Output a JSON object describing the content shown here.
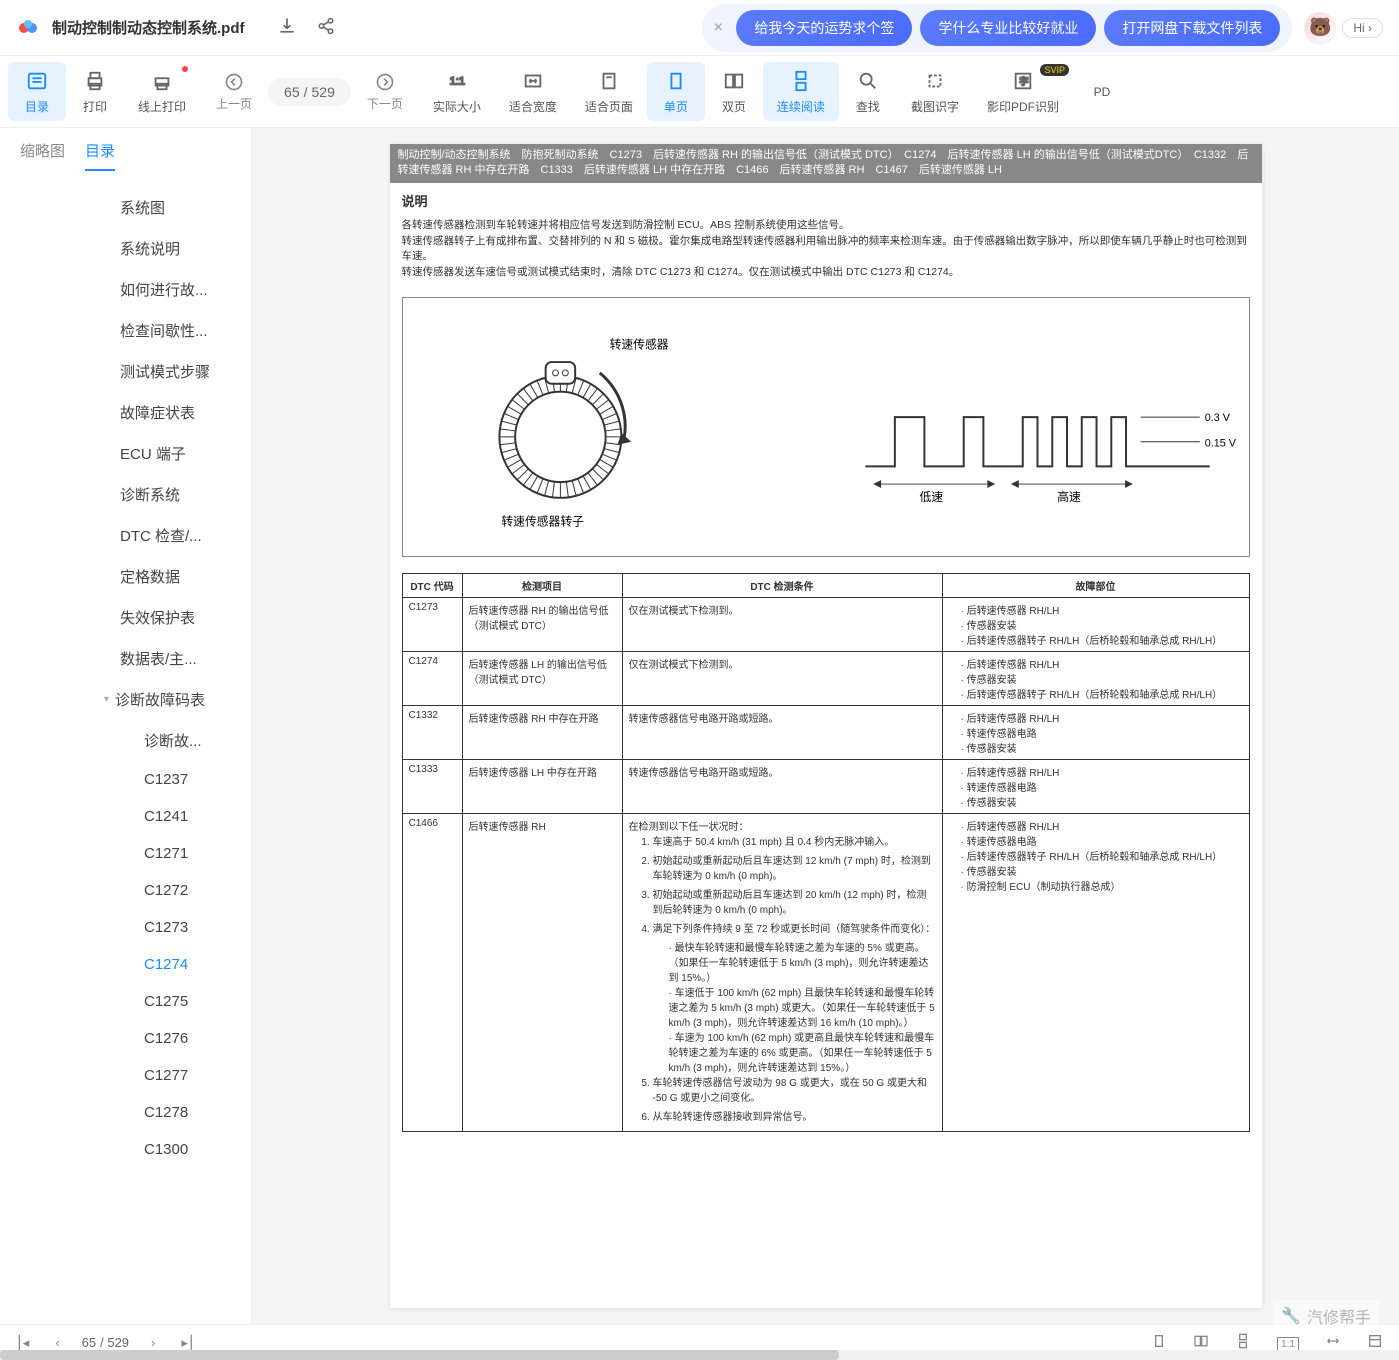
{
  "header": {
    "filename": "制动控制制动态控制系统.pdf",
    "hi_label": "Hi ›",
    "suggestions": [
      "给我今天的运势求个签",
      "学什么专业比较好就业",
      "打开网盘下载文件列表"
    ]
  },
  "toolbar": {
    "toc": "目录",
    "print": "打印",
    "online_print": "线上打印",
    "prev": "上一页",
    "next": "下一页",
    "actual_size": "实际大小",
    "fit_width": "适合宽度",
    "fit_page": "适合页面",
    "single": "单页",
    "double": "双页",
    "continuous": "连续阅读",
    "find": "查找",
    "screenshot": "截图识字",
    "ocr": "影印PDF识别",
    "pdf_convert": "PD",
    "page_current": "65",
    "page_total": "529",
    "svip": "SVIP"
  },
  "tabs": {
    "thumbnail": "缩略图",
    "toc": "目录"
  },
  "toc": [
    {
      "label": "系统图",
      "level": 1
    },
    {
      "label": "系统说明",
      "level": 1
    },
    {
      "label": "如何进行故...",
      "level": 1
    },
    {
      "label": "检查间歇性...",
      "level": 1
    },
    {
      "label": "测试模式步骤",
      "level": 1
    },
    {
      "label": "故障症状表",
      "level": 1
    },
    {
      "label": "ECU 端子",
      "level": 1
    },
    {
      "label": "诊断系统",
      "level": 1
    },
    {
      "label": "DTC 检查/...",
      "level": 1
    },
    {
      "label": "定格数据",
      "level": 1
    },
    {
      "label": "失效保护表",
      "level": 1
    },
    {
      "label": "数据表/主...",
      "level": 1
    },
    {
      "label": "诊断故障码表",
      "level": 1,
      "expandable": true
    },
    {
      "label": "诊断故...",
      "level": 2
    },
    {
      "label": "C1237",
      "level": 2
    },
    {
      "label": "C1241",
      "level": 2
    },
    {
      "label": "C1271",
      "level": 2
    },
    {
      "label": "C1272",
      "level": 2
    },
    {
      "label": "C1273",
      "level": 2
    },
    {
      "label": "C1274",
      "level": 2,
      "selected": true
    },
    {
      "label": "C1275",
      "level": 2
    },
    {
      "label": "C1276",
      "level": 2
    },
    {
      "label": "C1277",
      "level": 2
    },
    {
      "label": "C1278",
      "level": 2
    },
    {
      "label": "C1300",
      "level": 2
    }
  ],
  "page": {
    "header_band": "制动控制/动态控制系统　防抱死制动系统　C1273　后转速传感器 RH 的输出信号低（测试模式 DTC）　C1274　后转速传感器 LH 的输出信号低（测试模式DTC）　C1332　后转速传感器 RH 中存在开路　C1333　后转速传感器 LH 中存在开路　C1466　后转速传感器 RH　C1467　后转速传感器 LH",
    "section_title": "说明",
    "para1": "各转速传感器检测到车轮转速并将相应信号发送到防滑控制 ECU。ABS 控制系统使用这些信号。",
    "para2": "转速传感器转子上有成排布置、交替排列的 N 和 S 磁极。霍尔集成电路型转速传感器利用输出脉冲的频率来检测车速。由于传感器输出数字脉冲，所以即使车辆几乎静止时也可检测到车速。",
    "para3": "转速传感器发送车速信号或测试模式结束时，清除 DTC C1273 和 C1274。仅在测试模式中输出 DTC C1273 和 C1274。",
    "diag": {
      "sensor_label": "转速传感器",
      "rotor_label": "转速传感器转子",
      "low_speed": "低速",
      "high_speed": "高速",
      "v1": "0.3 V",
      "v2": "0.15 V"
    },
    "table": {
      "headers": [
        "DTC 代码",
        "检测项目",
        "DTC 检测条件",
        "故障部位"
      ],
      "rows": [
        {
          "code": "C1273",
          "item": "后转速传感器 RH 的输出信号低（测试模式 DTC）",
          "cond": "仅在测试模式下检测到。",
          "fault": [
            "后转速传感器 RH/LH",
            "传感器安装",
            "后转速传感器转子 RH/LH（后桥轮毂和轴承总成 RH/LH）"
          ]
        },
        {
          "code": "C1274",
          "item": "后转速传感器 LH 的输出信号低（测试模式 DTC）",
          "cond": "仅在测试模式下检测到。",
          "fault": [
            "后转速传感器 RH/LH",
            "传感器安装",
            "后转速传感器转子 RH/LH（后桥轮毂和轴承总成 RH/LH）"
          ]
        },
        {
          "code": "C1332",
          "item": "后转速传感器 RH 中存在开路",
          "cond": "转速传感器信号电路开路或短路。",
          "fault": [
            "后转速传感器 RH/LH",
            "转速传感器电路",
            "传感器安装"
          ]
        },
        {
          "code": "C1333",
          "item": "后转速传感器 LH 中存在开路",
          "cond": "转速传感器信号电路开路或短路。",
          "fault": [
            "后转速传感器 RH/LH",
            "转速传感器电路",
            "传感器安装"
          ]
        },
        {
          "code": "C1466",
          "item": "后转速传感器 RH",
          "cond_intro": "在检测到以下任一状况时：",
          "cond_list": [
            "车速高于 50.4 km/h (31 mph) 且 0.4 秒内无脉冲输入。",
            "初始起动或重新起动后且车速达到 12 km/h (7 mph) 时，检测到车轮转速为 0 km/h (0 mph)。",
            "初始起动或重新起动后且车速达到 20 km/h (12 mph) 时，检测到后轮转速为 0 km/h (0 mph)。",
            "满足下列条件持续 9 至 72 秒或更长时间（随驾驶条件而变化）："
          ],
          "cond_sub": [
            "最快车轮转速和最慢车轮转速之差为车速的 5% 或更高。（如果任一车轮转速低于 5 km/h (3 mph)，则允许转速差达到 15%。）",
            "车速低于 100 km/h (62 mph) 且最快车轮转速和最慢车轮转速之差为 5 km/h (3 mph) 或更大。（如果任一车轮转速低于 5 km/h (3 mph)，则允许转速差达到 16 km/h (10 mph)。）",
            "车速为 100 km/h (62 mph) 或更高且最快车轮转速和最慢车轮转速之差为车速的 6% 或更高。（如果任一车轮转速低于 5 km/h (3 mph)，则允许转速差达到 15%。）"
          ],
          "cond_list2": [
            "车轮转速传感器信号波动为 98 G 或更大，或在 50 G 或更大和 -50 G 或更小之间变化。",
            "从车轮转速传感器接收到异常信号。"
          ],
          "fault": [
            "后转速传感器 RH/LH",
            "转速传感器电路",
            "后转速传感器转子 RH/LH（后桥轮毂和轴承总成 RH/LH）",
            "传感器安装",
            "防滑控制 ECU（制动执行器总成）"
          ]
        }
      ]
    }
  },
  "footer": {
    "page_cur": "65",
    "page_total": "/ 529",
    "watermark": "汽修帮手"
  }
}
